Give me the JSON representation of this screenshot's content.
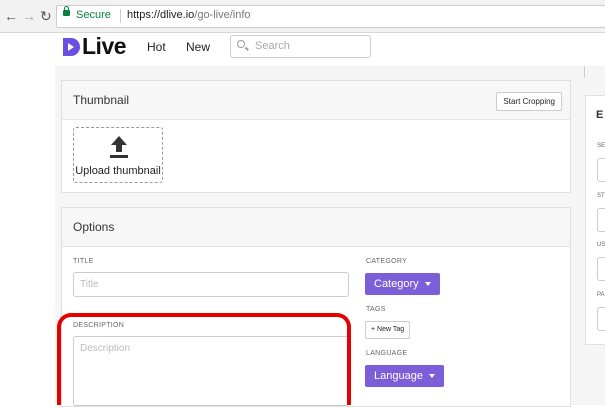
{
  "browser": {
    "secure_label": "Secure",
    "url_host": "https://dlive.io",
    "url_path": "/go-live/info"
  },
  "nav": {
    "logo_text": "Live",
    "links": [
      "Hot",
      "New"
    ],
    "search_placeholder": "Search"
  },
  "thumbnail": {
    "title": "Thumbnail",
    "crop_button": "Start Cropping",
    "upload_label": "Upload thumbnail"
  },
  "options": {
    "title": "Options",
    "title_label": "TITLE",
    "title_placeholder": "Title",
    "description_label": "DESCRIPTION",
    "description_placeholder": "Description",
    "category_label": "CATEGORY",
    "category_button": "Category",
    "tags_label": "TAGS",
    "new_tag_button": "+ New Tag",
    "language_label": "LANGUAGE",
    "language_button": "Language"
  },
  "right_panel": {
    "title_initial": "E",
    "labels": [
      "SE",
      "ST",
      "US",
      "PA"
    ]
  },
  "colors": {
    "accent": "#7b5ed8",
    "highlight": "#e60000",
    "secure": "#0b8043"
  }
}
